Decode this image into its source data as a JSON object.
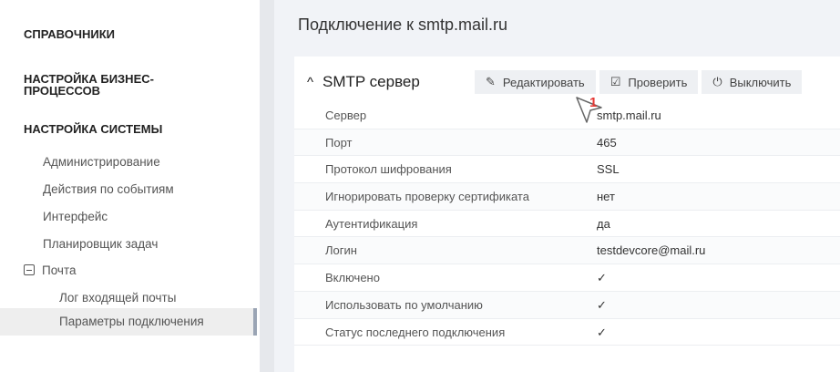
{
  "sidebar": {
    "sections": [
      {
        "label": "СПРАВОЧНИКИ",
        "chevron": "chevron-down-icon"
      },
      {
        "label": "НАСТРОЙКА БИЗНЕС-\nПРОЦЕССОВ",
        "chevron": "chevron-down-icon"
      },
      {
        "label": "НАСТРОЙКА СИСТЕМЫ",
        "chevron": "chevron-up-icon"
      }
    ],
    "items": [
      {
        "label": "Администрирование"
      },
      {
        "label": "Действия по событиям"
      },
      {
        "label": "Интерфейс"
      },
      {
        "label": "Планировщик задач"
      },
      {
        "label": "Почта",
        "icon": "collapse-minus-icon"
      }
    ],
    "subitems": [
      {
        "label": "Лог входящей почты"
      },
      {
        "label": "Параметры подключения",
        "active": true
      }
    ]
  },
  "page": {
    "title": "Подключение к smtp.mail.ru"
  },
  "card": {
    "title": "SMTP сервер",
    "caret": "^",
    "buttons": [
      {
        "label": "Редактировать",
        "icon": "pencil-icon"
      },
      {
        "label": "Проверить",
        "icon": "check-box-icon"
      },
      {
        "label": "Выключить",
        "icon": "power-icon"
      }
    ],
    "rows": [
      {
        "key": "Сервер",
        "value": "smtp.mail.ru"
      },
      {
        "key": "Порт",
        "value": "465"
      },
      {
        "key": "Протокол шифрования",
        "value": "SSL"
      },
      {
        "key": "Игнорировать проверку сертификата",
        "value": "нет"
      },
      {
        "key": "Аутентификация",
        "value": "да"
      },
      {
        "key": "Логин",
        "value": "testdevcore@mail.ru"
      },
      {
        "key": "Включено",
        "value": "✓"
      },
      {
        "key": "Использовать по умолчанию",
        "value": "✓"
      },
      {
        "key": "Статус последнего подключения",
        "value": "✓"
      }
    ]
  },
  "annotation": {
    "number": "1"
  },
  "colors": {
    "check": "#4caf50",
    "annotation": "#e53935",
    "main_bg": "#f1f3f7"
  }
}
